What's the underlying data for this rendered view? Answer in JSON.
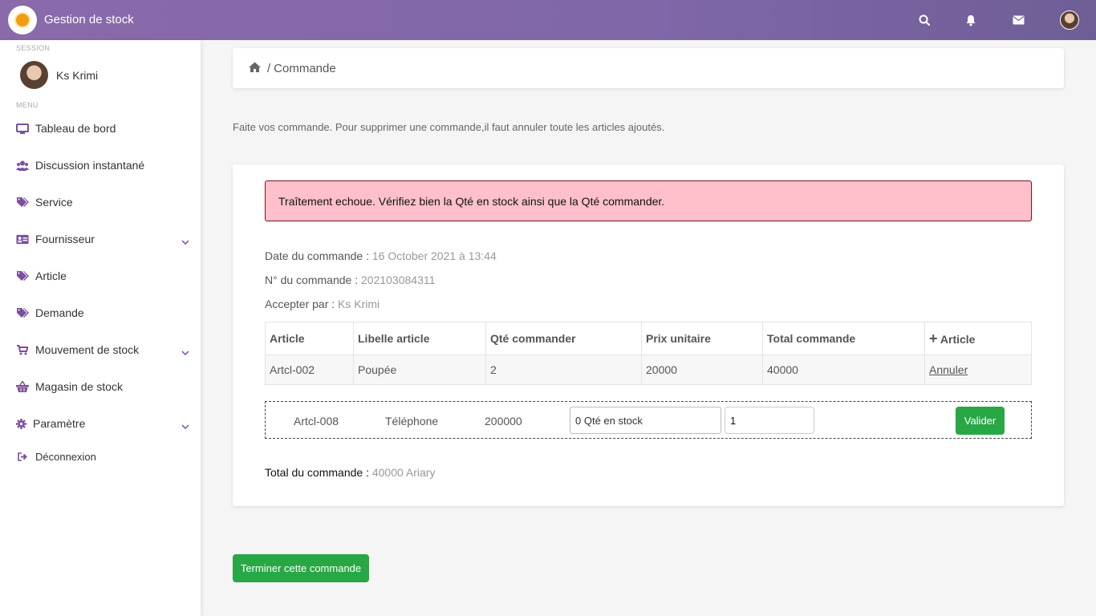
{
  "topbar": {
    "title": "Gestion de stock",
    "icons": [
      "search-icon",
      "bell-icon",
      "envelope-icon",
      "user-avatar"
    ]
  },
  "sidebar": {
    "session_caption": "SESSION",
    "user_name": "Ks Krimi",
    "menu_caption": "MENU",
    "items": [
      {
        "label": "Tableau de bord",
        "icon": "monitor-icon"
      },
      {
        "label": "Discussion instantané",
        "icon": "users-icon"
      },
      {
        "label": "Service",
        "icon": "tags-icon"
      },
      {
        "label": "Fournisseur",
        "icon": "id-card-icon",
        "expandable": true
      },
      {
        "label": "Article",
        "icon": "tags-icon"
      },
      {
        "label": "Demande",
        "icon": "tags-icon"
      },
      {
        "label": "Mouvement de stock",
        "icon": "cart-icon",
        "expandable": true
      },
      {
        "label": "Magasin de stock",
        "icon": "basket-icon"
      },
      {
        "label": "Paramètre",
        "icon": "gear-icon",
        "expandable": true
      },
      {
        "label": "Déconnexion",
        "icon": "sign-out-icon"
      }
    ]
  },
  "breadcrumb": {
    "separator": "/",
    "current": "Commande"
  },
  "intro": "Faite vos commande. Pour supprimer une commande,il faut annuler toute les articles ajoutés.",
  "order": {
    "alert": "Traîtement echoue. Vérifiez bien la Qté en stock ainsi que la Qté commander.",
    "date_label": "Date du commande :",
    "date_value": "16 October 2021 à 13:44",
    "number_label": "N° du commande :",
    "number_value": "202103084311",
    "accepted_label": "Accepter par :",
    "accepted_value": "Ks Krimi",
    "table": {
      "headers": [
        "Article",
        "Libelle article",
        "Qté commander",
        "Prix unitaire",
        "Total commande",
        "Article"
      ],
      "add_header_symbol": "+",
      "rows": [
        {
          "article": "Artcl-002",
          "libelle": "Poupée",
          "qte": "2",
          "prix": "20000",
          "total": "40000",
          "action": "Annuler"
        }
      ]
    },
    "add_row": {
      "article": "Artcl-008",
      "libelle": "Téléphone",
      "prix": "200000",
      "stock_value": "0 Qté en stock",
      "qty_value": "1",
      "submit": "Valider"
    },
    "total_label": "Total du commande :",
    "total_value": "40000 Ariary"
  },
  "finish_button": "Terminer cette commande",
  "colors": {
    "topbar": "#8a6aab",
    "accent_icon": "#7b4f9d",
    "success": "#28a745",
    "alert_bg": "#ffc0cb"
  }
}
